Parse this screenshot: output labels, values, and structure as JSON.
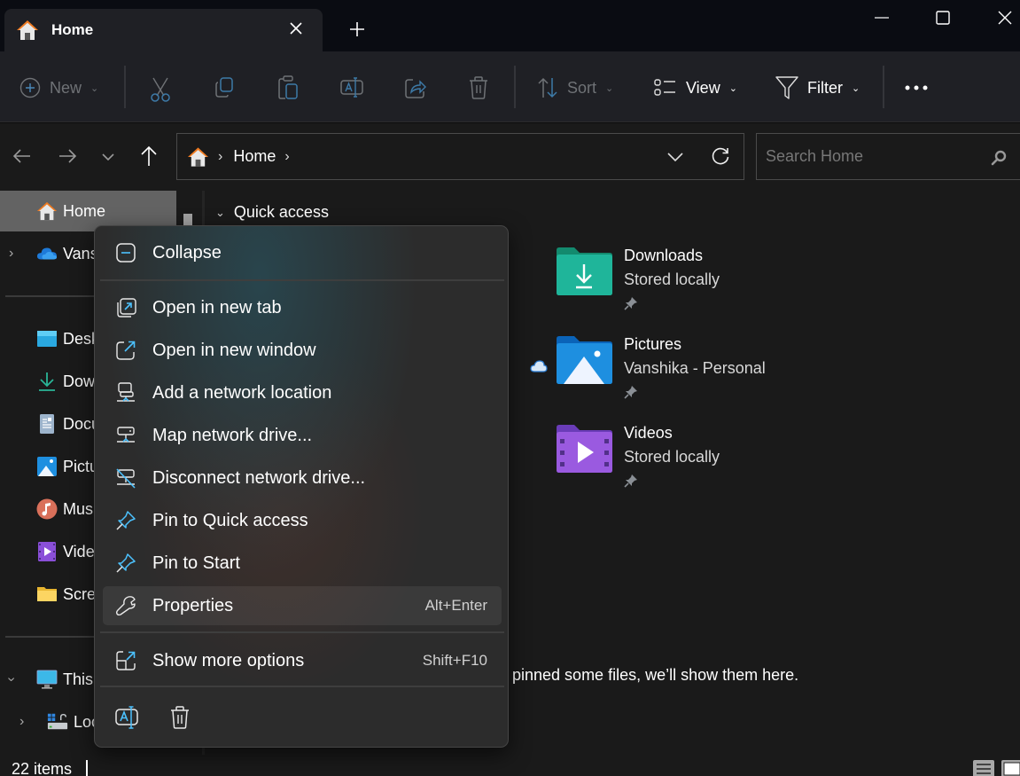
{
  "window": {
    "tab_title": "Home",
    "controls": {
      "minimize": "minimize-icon",
      "maximize": "maximize-icon",
      "close": "close-icon"
    }
  },
  "toolbar": {
    "new_label": "New",
    "sort_label": "Sort",
    "view_label": "View",
    "filter_label": "Filter",
    "icons": [
      "plus-circle-icon",
      "cut-icon",
      "copy-icon",
      "paste-icon",
      "rename-icon",
      "share-icon",
      "delete-icon",
      "sort-icon",
      "view-icon",
      "filter-icon",
      "more-icon"
    ]
  },
  "address": {
    "breadcrumb": [
      "Home"
    ],
    "search_placeholder": "Search Home"
  },
  "nav": {
    "items": [
      {
        "label": "Home",
        "icon": "home-icon",
        "selected": true
      },
      {
        "label": "Vanshika - Personal",
        "icon": "onedrive-icon"
      },
      {
        "label": "Desktop",
        "icon": "desktop-icon"
      },
      {
        "label": "Downloads",
        "icon": "download-icon"
      },
      {
        "label": "Documents",
        "icon": "documents-icon"
      },
      {
        "label": "Pictures",
        "icon": "pictures-icon"
      },
      {
        "label": "Music",
        "icon": "music-icon"
      },
      {
        "label": "Videos",
        "icon": "videos-icon"
      },
      {
        "label": "Screenshots",
        "icon": "folder-icon"
      },
      {
        "label": "This PC",
        "icon": "pc-icon"
      },
      {
        "label": "Local Disk (C:)",
        "icon": "drive-icon"
      }
    ]
  },
  "content": {
    "section_title": "Quick access",
    "folders": [
      {
        "name": "Downloads",
        "sub": "Stored locally",
        "color": "#1fb59a"
      },
      {
        "name": "Pictures",
        "sub": "Vanshika - Personal",
        "color": "#1e8fe0"
      },
      {
        "name": "Videos",
        "sub": "Stored locally",
        "color": "#8a4fd8"
      }
    ],
    "empty_message": "pinned some files, we’ll show them here."
  },
  "context_menu": {
    "items": [
      {
        "label": "Collapse",
        "icon": "collapse-icon"
      },
      {
        "label": "Open in new tab",
        "icon": "open-new-tab-icon"
      },
      {
        "label": "Open in new window",
        "icon": "open-new-window-icon"
      },
      {
        "label": "Add a network location",
        "icon": "network-location-icon"
      },
      {
        "label": "Map network drive...",
        "icon": "map-drive-icon"
      },
      {
        "label": "Disconnect network drive...",
        "icon": "disconnect-drive-icon"
      },
      {
        "label": "Pin to Quick access",
        "icon": "pin-icon"
      },
      {
        "label": "Pin to Start",
        "icon": "pin-icon"
      },
      {
        "label": "Properties",
        "icon": "wrench-icon",
        "shortcut": "Alt+Enter"
      },
      {
        "label": "Show more options",
        "icon": "more-options-icon",
        "shortcut": "Shift+F10"
      }
    ],
    "bottom_buttons": [
      "rename-icon",
      "delete-icon"
    ]
  },
  "status": {
    "item_count": "22 items"
  },
  "colors": {
    "accent": "#4cc2ff",
    "home_orange": "#f07b21"
  }
}
